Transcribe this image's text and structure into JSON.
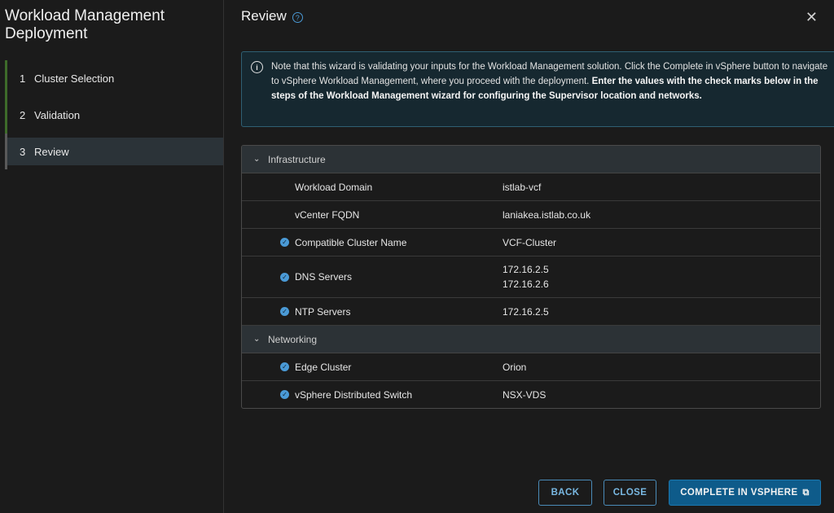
{
  "wizard": {
    "title": "Workload Management Deployment",
    "steps": [
      {
        "num": "1",
        "label": "Cluster Selection"
      },
      {
        "num": "2",
        "label": "Validation"
      },
      {
        "num": "3",
        "label": "Review"
      }
    ]
  },
  "main": {
    "title": "Review",
    "close_glyph": "✕",
    "alert": {
      "text_plain": "Note that this wizard is validating your inputs for the Workload Management solution. Click the Complete in vSphere button to navigate to vSphere Workload Management, where you proceed with the deployment. ",
      "text_bold": "Enter the values with the check marks below in the steps of the Workload Management wizard for configuring the Supervisor location and networks."
    },
    "groups": [
      {
        "label": "Infrastructure",
        "rows": [
          {
            "label": "Workload Domain",
            "value": "istlab-vcf"
          },
          {
            "label": "vCenter FQDN",
            "value": "laniakea.istlab.co.uk"
          },
          {
            "label": "Compatible Cluster Name",
            "value": "VCF-Cluster"
          },
          {
            "label": "DNS Servers",
            "value": "172.16.2.5",
            "value2": "172.16.2.6"
          },
          {
            "label": "NTP Servers",
            "value": "172.16.2.5"
          }
        ]
      },
      {
        "label": "Networking",
        "rows": [
          {
            "label": "Edge Cluster",
            "value": "Orion"
          },
          {
            "label": "vSphere Distributed Switch",
            "value": "NSX-VDS"
          }
        ]
      }
    ]
  },
  "footer": {
    "back_label": "BACK",
    "close_label": "CLOSE",
    "complete_label": "COMPLETE IN VSPHERE"
  }
}
